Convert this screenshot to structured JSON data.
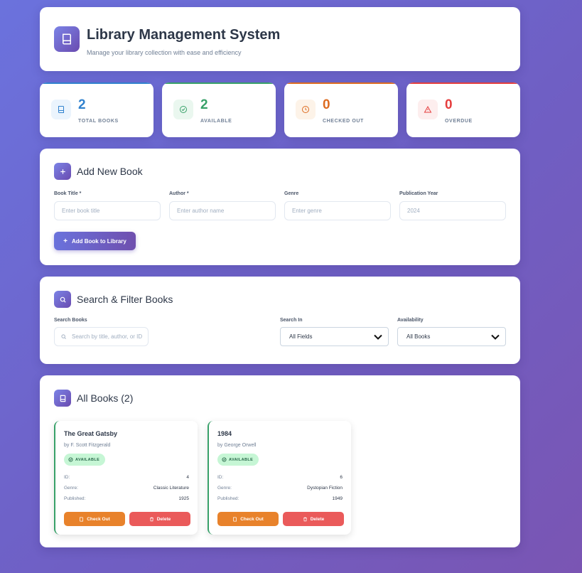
{
  "header": {
    "title": "Library Management System",
    "subtitle": "Manage your library collection with ease and efficiency"
  },
  "stats": [
    {
      "value": "2",
      "label": "TOTAL BOOKS",
      "color": "#3182ce",
      "icon": "book-icon"
    },
    {
      "value": "2",
      "label": "AVAILABLE",
      "color": "#38a169",
      "icon": "check-circle-icon"
    },
    {
      "value": "0",
      "label": "CHECKED OUT",
      "color": "#dd6b20",
      "icon": "clock-icon"
    },
    {
      "value": "0",
      "label": "OVERDUE",
      "color": "#e53e3e",
      "icon": "warning-icon"
    }
  ],
  "add_form": {
    "title": "Add New Book",
    "fields": [
      {
        "label": "Book Title *",
        "placeholder": "Enter book title"
      },
      {
        "label": "Author *",
        "placeholder": "Enter author name"
      },
      {
        "label": "Genre",
        "placeholder": "Enter genre"
      },
      {
        "label": "Publication Year",
        "placeholder": "2024"
      }
    ],
    "submit_label": "Add Book to Library"
  },
  "search": {
    "title": "Search & Filter Books",
    "search_label": "Search Books",
    "search_placeholder": "Search by title, author, or ID",
    "search_in_label": "Search In",
    "search_in_value": "All Fields",
    "availability_label": "Availability",
    "availability_value": "All Books"
  },
  "books_section": {
    "title": "All Books (2)",
    "labels": {
      "id": "ID:",
      "genre": "Genre:",
      "published": "Published:"
    },
    "checkout_label": "Check Out",
    "delete_label": "Delete",
    "books": [
      {
        "title": "The Great Gatsby",
        "author": "by F. Scott Fitzgerald",
        "status": "AVAILABLE",
        "id": "4",
        "genre": "Classic Literature",
        "published": "1925"
      },
      {
        "title": "1984",
        "author": "by George Orwell",
        "status": "AVAILABLE",
        "id": "6",
        "genre": "Dystopian Fiction",
        "published": "1949"
      }
    ]
  }
}
